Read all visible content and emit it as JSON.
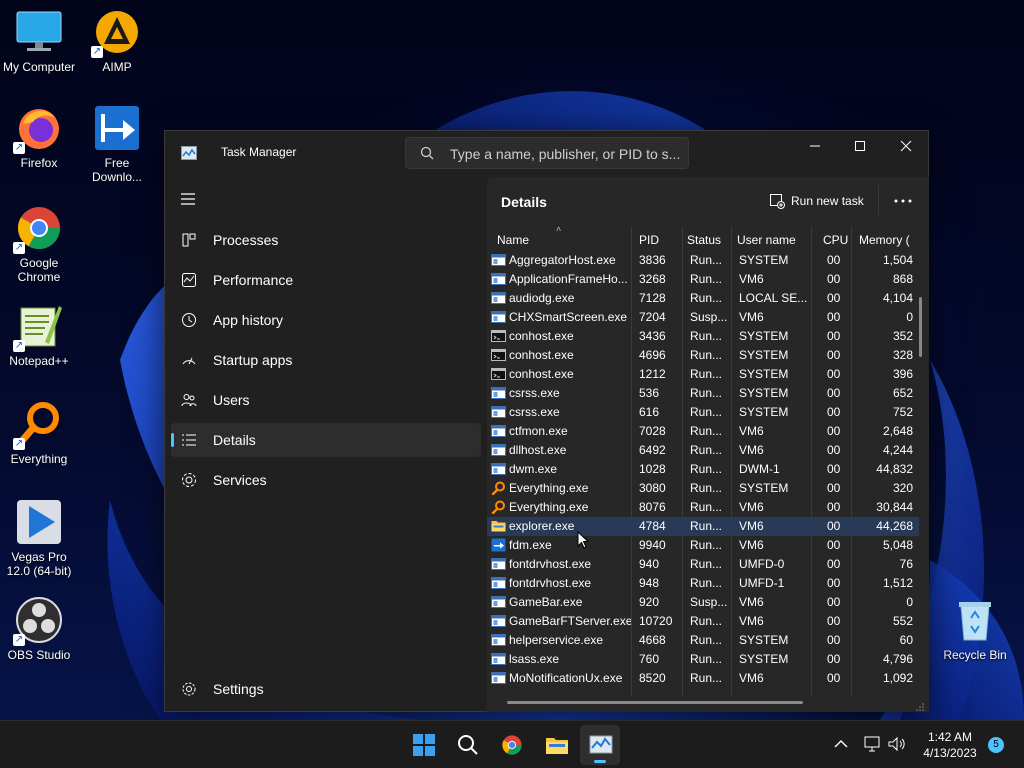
{
  "desktop": {
    "icons": [
      {
        "label": "My Computer",
        "icon": "monitor-icon"
      },
      {
        "label": "AIMP",
        "icon": "aimp-icon"
      },
      {
        "label": "Firefox",
        "icon": "firefox-icon"
      },
      {
        "label": "Free Downlo...",
        "icon": "fdm-icon"
      },
      {
        "label": "Google Chrome",
        "icon": "chrome-icon"
      },
      {
        "label": "Notepad++",
        "icon": "notepadpp-icon"
      },
      {
        "label": "Everything",
        "icon": "everything-icon"
      },
      {
        "label": "Vegas Pro 12.0 (64-bit)",
        "icon": "vegas-icon"
      },
      {
        "label": "OBS Studio",
        "icon": "obs-icon"
      },
      {
        "label": "Recycle Bin",
        "icon": "recycle-bin-icon"
      }
    ]
  },
  "window": {
    "title": "Task Manager",
    "search_placeholder": "Type a name, publisher, or PID to s..."
  },
  "sidebar": {
    "items": [
      {
        "label": "Processes",
        "icon": "processes-icon"
      },
      {
        "label": "Performance",
        "icon": "performance-icon"
      },
      {
        "label": "App history",
        "icon": "history-icon"
      },
      {
        "label": "Startup apps",
        "icon": "startup-icon"
      },
      {
        "label": "Users",
        "icon": "users-icon"
      },
      {
        "label": "Details",
        "icon": "details-icon",
        "active": true
      },
      {
        "label": "Services",
        "icon": "services-icon"
      }
    ],
    "settings_label": "Settings"
  },
  "main": {
    "title": "Details",
    "run_new_task_label": "Run new task",
    "columns": {
      "name": "Name",
      "pid": "PID",
      "status": "Status",
      "user": "User name",
      "cpu": "CPU",
      "memory": "Memory ("
    },
    "rows": [
      {
        "name": "AggregatorHost.exe",
        "pid": "3836",
        "status": "Run...",
        "user": "SYSTEM",
        "cpu": "00",
        "memory": "1,504",
        "icon": "app"
      },
      {
        "name": "ApplicationFrameHo...",
        "pid": "3268",
        "status": "Run...",
        "user": "VM6",
        "cpu": "00",
        "memory": "868",
        "icon": "app"
      },
      {
        "name": "audiodg.exe",
        "pid": "7128",
        "status": "Run...",
        "user": "LOCAL SE...",
        "cpu": "00",
        "memory": "4,104",
        "icon": "app"
      },
      {
        "name": "CHXSmartScreen.exe",
        "pid": "7204",
        "status": "Susp...",
        "user": "VM6",
        "cpu": "00",
        "memory": "0",
        "icon": "app"
      },
      {
        "name": "conhost.exe",
        "pid": "3436",
        "status": "Run...",
        "user": "SYSTEM",
        "cpu": "00",
        "memory": "352",
        "icon": "console"
      },
      {
        "name": "conhost.exe",
        "pid": "4696",
        "status": "Run...",
        "user": "SYSTEM",
        "cpu": "00",
        "memory": "328",
        "icon": "console"
      },
      {
        "name": "conhost.exe",
        "pid": "1212",
        "status": "Run...",
        "user": "SYSTEM",
        "cpu": "00",
        "memory": "396",
        "icon": "console"
      },
      {
        "name": "csrss.exe",
        "pid": "536",
        "status": "Run...",
        "user": "SYSTEM",
        "cpu": "00",
        "memory": "652",
        "icon": "app"
      },
      {
        "name": "csrss.exe",
        "pid": "616",
        "status": "Run...",
        "user": "SYSTEM",
        "cpu": "00",
        "memory": "752",
        "icon": "app"
      },
      {
        "name": "ctfmon.exe",
        "pid": "7028",
        "status": "Run...",
        "user": "VM6",
        "cpu": "00",
        "memory": "2,648",
        "icon": "app"
      },
      {
        "name": "dllhost.exe",
        "pid": "6492",
        "status": "Run...",
        "user": "VM6",
        "cpu": "00",
        "memory": "4,244",
        "icon": "app"
      },
      {
        "name": "dwm.exe",
        "pid": "1028",
        "status": "Run...",
        "user": "DWM-1",
        "cpu": "00",
        "memory": "44,832",
        "icon": "app"
      },
      {
        "name": "Everything.exe",
        "pid": "3080",
        "status": "Run...",
        "user": "SYSTEM",
        "cpu": "00",
        "memory": "320",
        "icon": "everything"
      },
      {
        "name": "Everything.exe",
        "pid": "8076",
        "status": "Run...",
        "user": "VM6",
        "cpu": "00",
        "memory": "30,844",
        "icon": "everything"
      },
      {
        "name": "explorer.exe",
        "pid": "4784",
        "status": "Run...",
        "user": "VM6",
        "cpu": "00",
        "memory": "44,268",
        "icon": "folder",
        "selected": true
      },
      {
        "name": "fdm.exe",
        "pid": "9940",
        "status": "Run...",
        "user": "VM6",
        "cpu": "00",
        "memory": "5,048",
        "icon": "fdm"
      },
      {
        "name": "fontdrvhost.exe",
        "pid": "940",
        "status": "Run...",
        "user": "UMFD-0",
        "cpu": "00",
        "memory": "76",
        "icon": "app"
      },
      {
        "name": "fontdrvhost.exe",
        "pid": "948",
        "status": "Run...",
        "user": "UMFD-1",
        "cpu": "00",
        "memory": "1,512",
        "icon": "app"
      },
      {
        "name": "GameBar.exe",
        "pid": "920",
        "status": "Susp...",
        "user": "VM6",
        "cpu": "00",
        "memory": "0",
        "icon": "app"
      },
      {
        "name": "GameBarFTServer.exe",
        "pid": "10720",
        "status": "Run...",
        "user": "VM6",
        "cpu": "00",
        "memory": "552",
        "icon": "app"
      },
      {
        "name": "helperservice.exe",
        "pid": "4668",
        "status": "Run...",
        "user": "SYSTEM",
        "cpu": "00",
        "memory": "60",
        "icon": "app"
      },
      {
        "name": "lsass.exe",
        "pid": "760",
        "status": "Run...",
        "user": "SYSTEM",
        "cpu": "00",
        "memory": "4,796",
        "icon": "app"
      },
      {
        "name": "MoNotificationUx.exe",
        "pid": "8520",
        "status": "Run...",
        "user": "VM6",
        "cpu": "00",
        "memory": "1,092",
        "icon": "app"
      }
    ]
  },
  "taskbar": {
    "items": [
      {
        "name": "start-button",
        "icon": "windows-icon"
      },
      {
        "name": "search-button",
        "icon": "search-icon"
      },
      {
        "name": "chrome-taskbar-button",
        "icon": "chrome-icon"
      },
      {
        "name": "file-explorer-taskbar-button",
        "icon": "folder-icon"
      },
      {
        "name": "task-manager-taskbar-button",
        "icon": "task-manager-icon",
        "active": true
      }
    ],
    "time": "1:42 AM",
    "date": "4/13/2023",
    "notification_count": "5"
  },
  "colors": {
    "accent": "#4cc2ff",
    "window_bg": "#202020",
    "main_bg": "#272727",
    "selected_row": "#283a55"
  }
}
